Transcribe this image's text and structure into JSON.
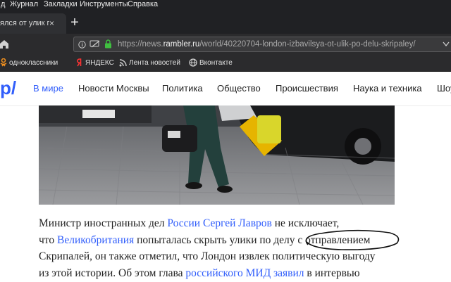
{
  "menu": {
    "items": [
      "д",
      "Журнал",
      "Закладки",
      "Инструменты",
      "Справка"
    ]
  },
  "tab": {
    "title": "ялся от улик по",
    "close": "×"
  },
  "newtab": "+",
  "url": {
    "prefix": "https://news.",
    "domain": "rambler.ru",
    "path": "/world/40220704-london-izbavilsya-ot-ulik-po-delu-skripaley/"
  },
  "bookmarks": [
    {
      "label": "одноклассники",
      "icon": "ok-icon"
    },
    {
      "label": "ЯНДЕКС",
      "icon": "yandex-icon"
    },
    {
      "label": "Лента новостей",
      "icon": "rss-icon"
    },
    {
      "label": "Вконтакте",
      "icon": "globe-icon"
    }
  ],
  "site": {
    "logo": "р/",
    "nav": [
      "В мире",
      "Новости Москвы",
      "Политика",
      "Общество",
      "Происшествия",
      "Наука и техника",
      "Шоу"
    ],
    "accent": "#315efb"
  },
  "article": {
    "l1": {
      "t1": "Министр иностранных дел ",
      "a1": "России Сергей Лавров",
      "t2": " не исключает,"
    },
    "l2": {
      "t1": "что ",
      "a1": "Великобритания",
      "t2": " попыталась скрыть улики по делу с отправлением"
    },
    "l3": "Скрипалей, он также отметил, что Лондон извлек политическую выгоду",
    "l4": {
      "t1": "из этой истории. Об этом глава ",
      "a1": "российского МИД",
      "t2": " ",
      "a2": "заявил",
      "t3": " в интервью"
    }
  }
}
